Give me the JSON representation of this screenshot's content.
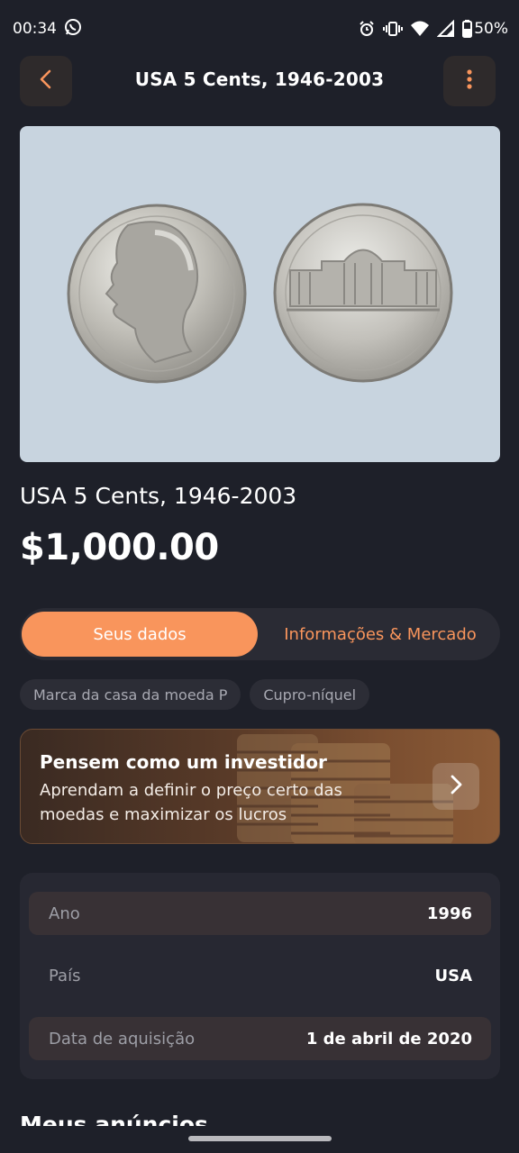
{
  "status_bar": {
    "time": "00:34",
    "battery": "50%"
  },
  "header": {
    "title": "USA 5 Cents, 1946-2003"
  },
  "coin": {
    "name": "USA 5 Cents, 1946-2003",
    "price": "$1,000.00"
  },
  "tabs": {
    "active": "Seus dados",
    "inactive": "Informações & Mercado"
  },
  "chips": [
    "Marca da casa da moeda P",
    "Cupro-níquel"
  ],
  "promo": {
    "title": "Pensem como um investidor",
    "text": "Aprendam a definir o preço certo das moedas e maximizar os lucros"
  },
  "details": [
    {
      "label": "Ano",
      "value": "1996"
    },
    {
      "label": "País",
      "value": "USA"
    },
    {
      "label": "Data de aquisição",
      "value": "1 de abril de 2020"
    }
  ],
  "section_title": "Meus anúncios",
  "colors": {
    "background": "#1e2029",
    "accent": "#f9955c",
    "card": "#272832",
    "image_background": "#c8d4df"
  },
  "icons": {
    "back": "chevron-left-icon",
    "more": "more-vertical-icon",
    "promo": "chevron-right-icon",
    "status": [
      "whatsapp-icon",
      "alarm-icon",
      "vibrate-icon",
      "wifi-icon",
      "signal-icon",
      "battery-icon"
    ]
  }
}
